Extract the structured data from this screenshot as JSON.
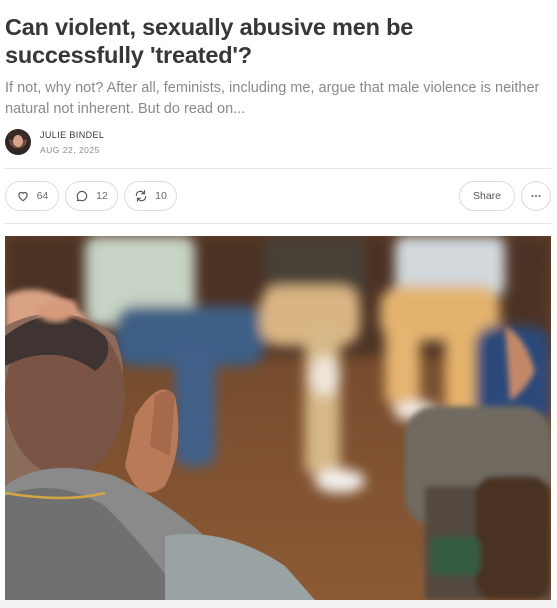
{
  "post": {
    "title": "Can violent, sexually abusive men be successfully 'treated'?",
    "subtitle": "If not, why not? After all, feminists, including me, argue that male violence is neither natural not inherent. But do read on...",
    "author": "JULIE BINDEL",
    "date": "AUG 22, 2025"
  },
  "actions": {
    "likes": "64",
    "comments": "12",
    "restacks": "10",
    "share_label": "Share"
  },
  "icons": {
    "like": "heart-icon",
    "comment": "speech-bubble-icon",
    "restack": "restack-arrows-icon",
    "more": "ellipsis-icon"
  },
  "colors": {
    "text": "#363737",
    "muted": "#8a8a8a",
    "border": "#dcdcdc"
  }
}
